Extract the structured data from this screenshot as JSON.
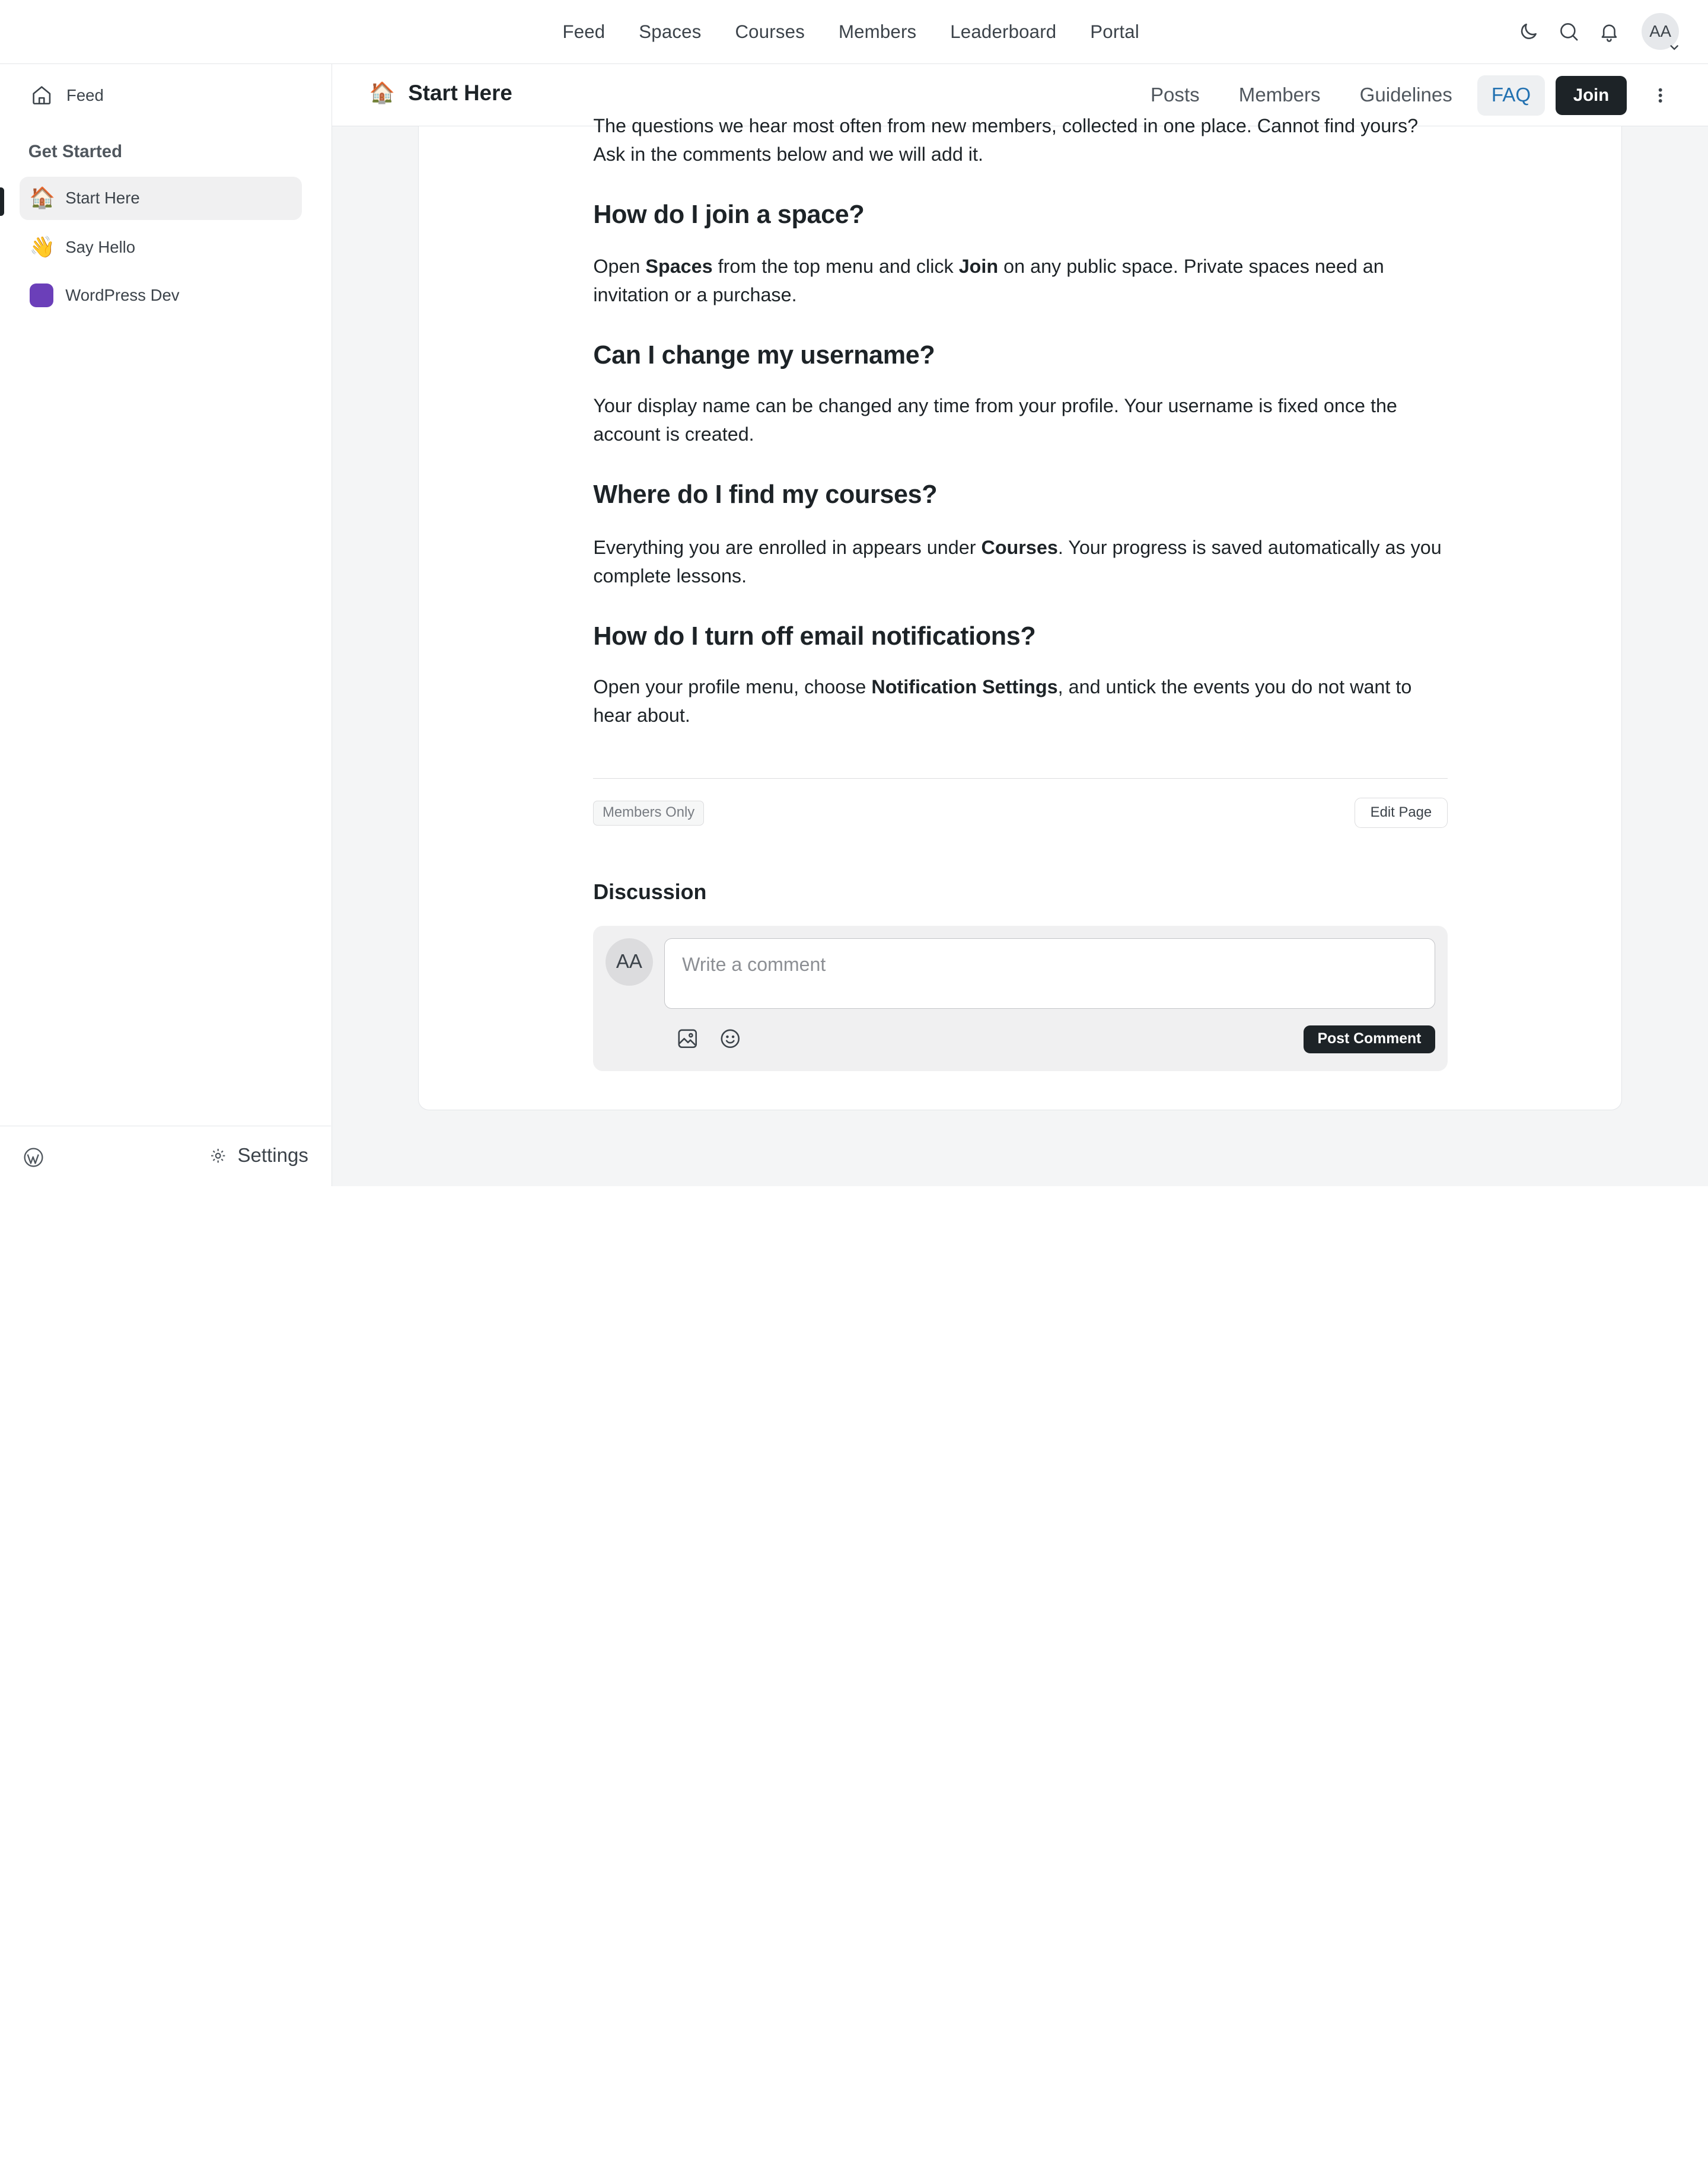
{
  "topnav": {
    "items": [
      "Feed",
      "Spaces",
      "Courses",
      "Members",
      "Leaderboard",
      "Portal"
    ],
    "avatar_initials": "AA"
  },
  "sidebar": {
    "feed_label": "Feed",
    "group_title": "Get Started",
    "items": [
      {
        "label": "Start Here",
        "emoji": "🏠",
        "active": true
      },
      {
        "label": "Say Hello",
        "emoji": "👋",
        "active": false
      },
      {
        "label": "WordPress Dev",
        "color": "#6b3fb9",
        "active": false
      }
    ],
    "settings_label": "Settings"
  },
  "space": {
    "emoji": "🏠",
    "title": "Start Here",
    "tabs": [
      "Posts",
      "Members",
      "Guidelines",
      "FAQ"
    ],
    "active_tab": "FAQ",
    "join_label": "Join"
  },
  "article": {
    "intro_line1": "The questions we hear most often from new members, collected in one place. Cannot find yours?",
    "intro_line2": "Ask in the comments below and we will add it.",
    "faqs": [
      {
        "question": "How do I join a space?",
        "a_pre": "Open ",
        "a_b1": "Spaces",
        "a_mid": " from the top menu and click ",
        "a_b2": "Join",
        "a_post": " on any public space. Private spaces need an invitation or a purchase."
      },
      {
        "question": "Can I change my username?",
        "a_pre": "Your display name can be changed any time from your profile. Your username is fixed once the account is created."
      },
      {
        "question": "Where do I find my courses?",
        "a_pre": "Everything you are enrolled in appears under ",
        "a_b1": "Courses",
        "a_post": ". Your progress is saved automatically as you complete lessons."
      },
      {
        "question": "How do I turn off email notifications?",
        "a_pre": "Open your profile menu, choose ",
        "a_b1": "Notification Settings",
        "a_post": ", and untick the events you do not want to hear about."
      }
    ],
    "badge": "Members Only",
    "edit_label": "Edit Page"
  },
  "discussion": {
    "title": "Discussion",
    "avatar_initials": "AA",
    "placeholder": "Write a comment",
    "post_label": "Post Comment"
  },
  "colors": {
    "accent": "#2271b1",
    "dark_button": "#1d2327",
    "space_dot": "#6b3fb9"
  }
}
